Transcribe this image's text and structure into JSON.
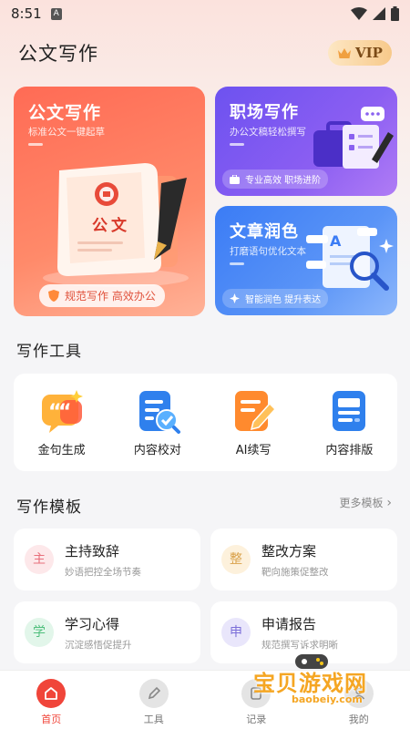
{
  "status": {
    "time": "8:51"
  },
  "header": {
    "title": "公文写作",
    "vip_label": "VIP"
  },
  "cards": {
    "main": {
      "title": "公文写作",
      "subtitle": "标准公文一键起草",
      "doc_text": "公文",
      "tags": "规范写作  高效办公"
    },
    "work": {
      "title": "职场写作",
      "subtitle": "办公文稿轻松撰写",
      "tags": "专业高效  职场进阶"
    },
    "polish": {
      "title": "文章润色",
      "subtitle": "打磨语句优化文本",
      "tags": "智能润色  提升表达"
    }
  },
  "tools_section": {
    "title": "写作工具",
    "items": [
      {
        "label": "金句生成",
        "icon": "quote-icon",
        "color": "#ff8a2e"
      },
      {
        "label": "内容校对",
        "icon": "proofread-icon",
        "color": "#2f80ed"
      },
      {
        "label": "AI续写",
        "icon": "ai-write-icon",
        "color": "#ff7a2e"
      },
      {
        "label": "内容排版",
        "icon": "layout-icon",
        "color": "#2f80ed"
      }
    ]
  },
  "templates_section": {
    "title": "写作模板",
    "more": "更多模板",
    "items": [
      {
        "badge": "主",
        "title": "主持致辞",
        "desc": "妙语把控全场节奏"
      },
      {
        "badge": "整",
        "title": "整改方案",
        "desc": "靶向施策促整改"
      },
      {
        "badge": "学",
        "title": "学习心得",
        "desc": "沉淀感悟促提升"
      },
      {
        "badge": "申",
        "title": "申请报告",
        "desc": "规范撰写诉求明晰"
      }
    ]
  },
  "nav": [
    {
      "label": "首页",
      "icon": "home-icon"
    },
    {
      "label": "工具",
      "icon": "pen-icon"
    },
    {
      "label": "记录",
      "icon": "record-icon"
    },
    {
      "label": "我的",
      "icon": "user-icon"
    }
  ],
  "watermark": {
    "title": "宝贝游戏网",
    "url": "baobeiy.com"
  }
}
